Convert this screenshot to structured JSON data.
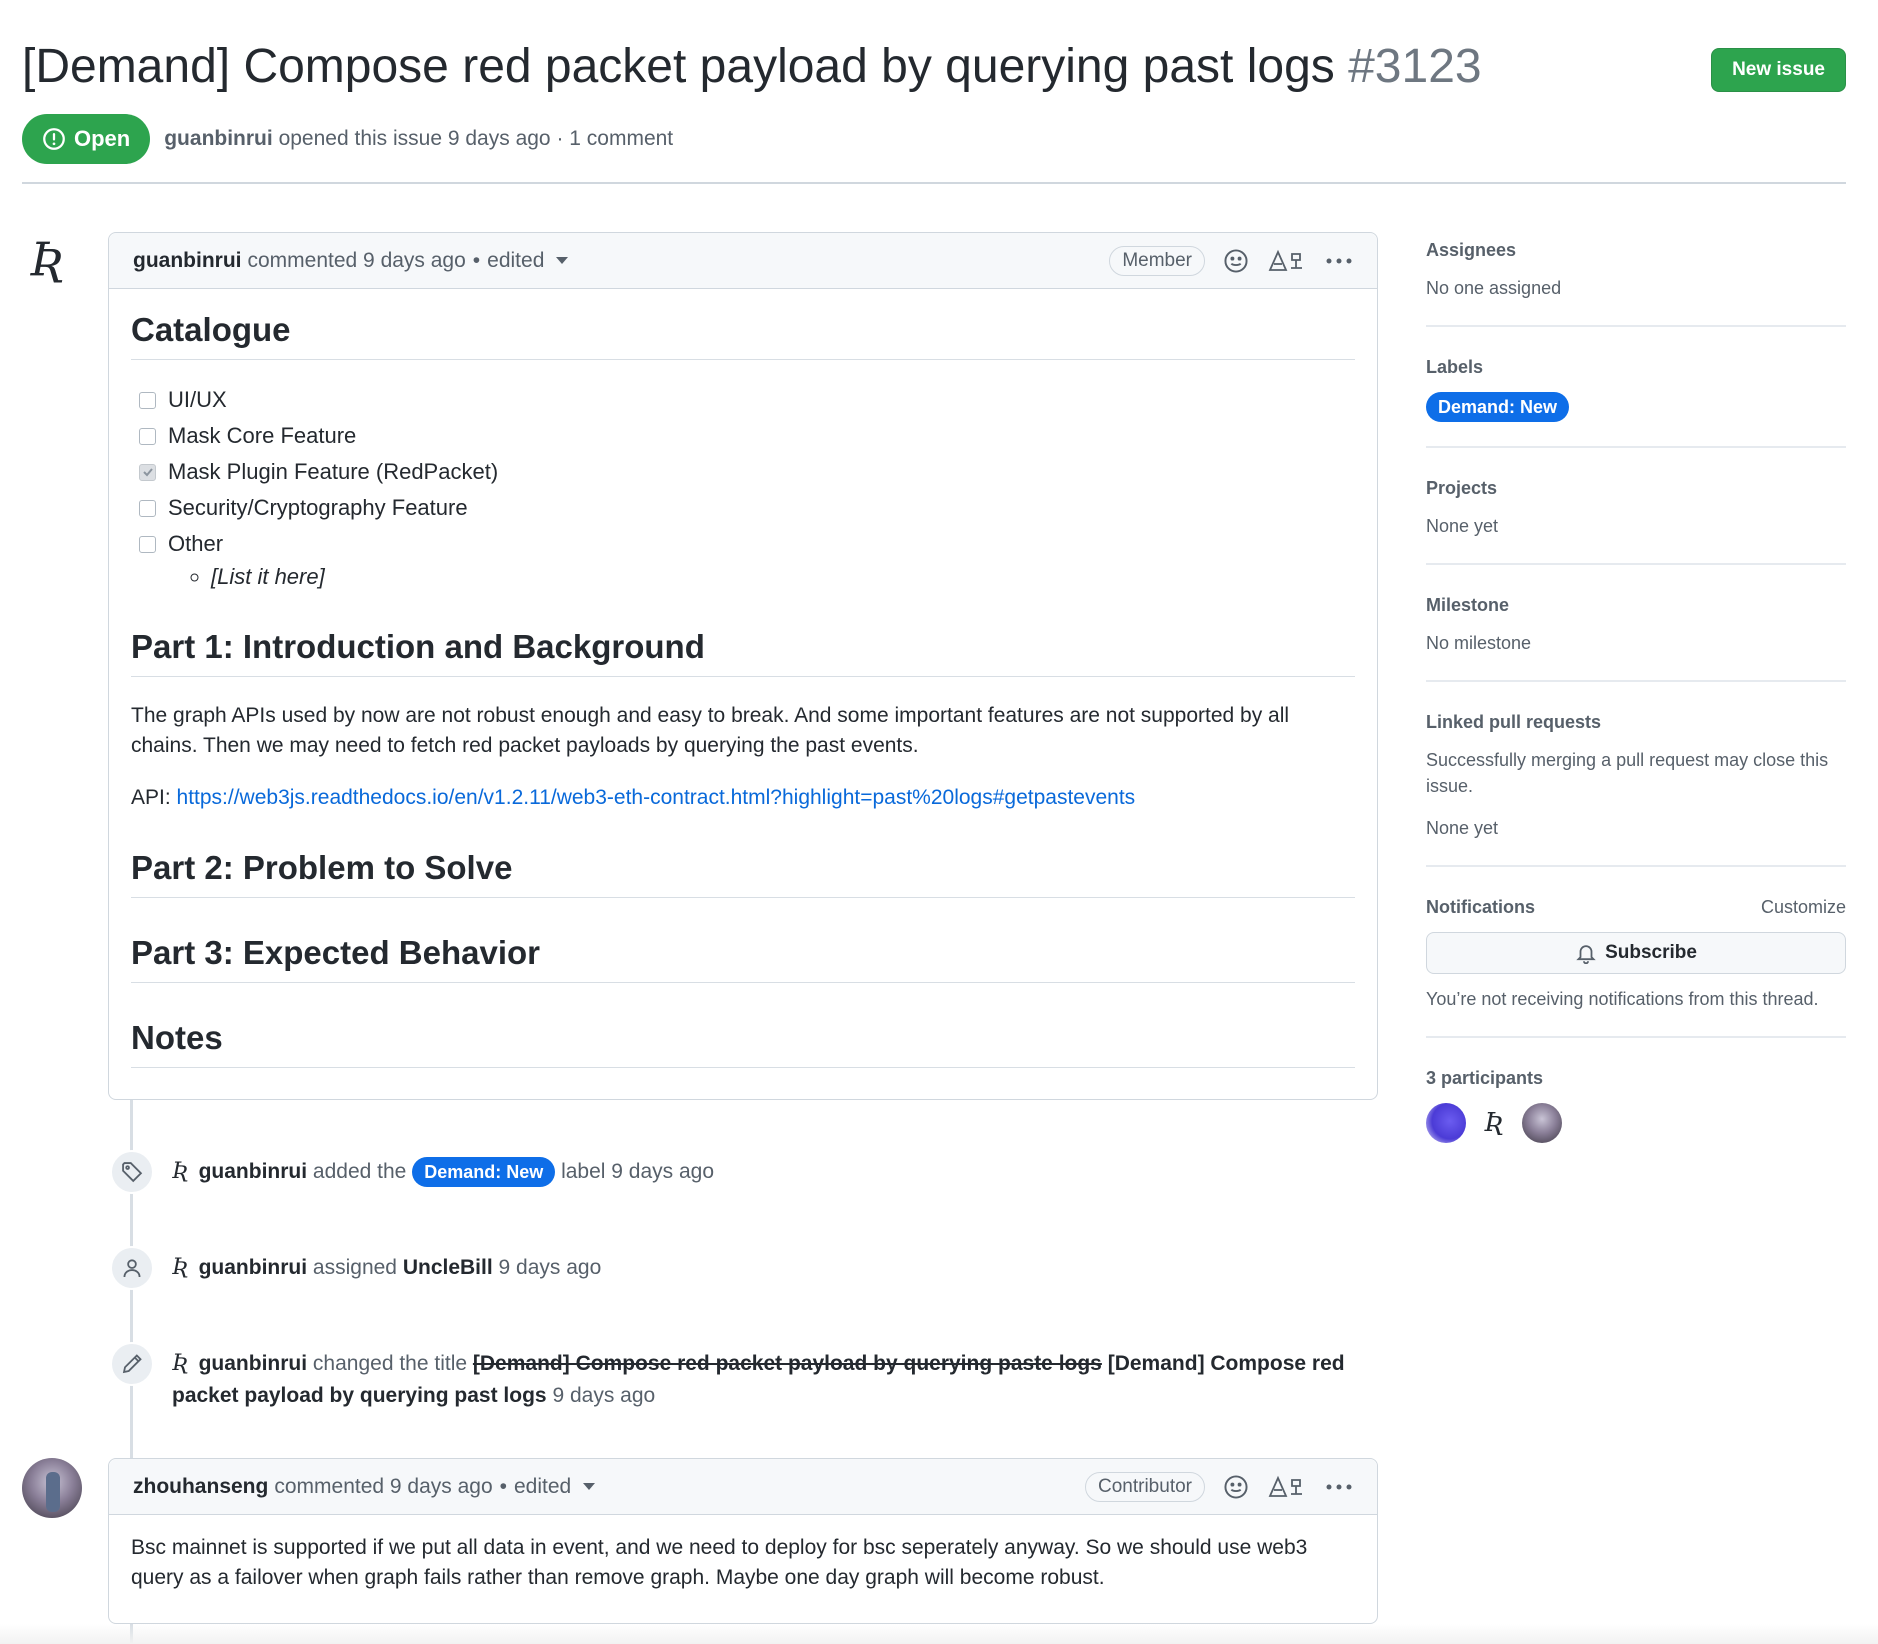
{
  "header": {
    "title": "[Demand] Compose red packet payload by querying past logs",
    "number": "#3123",
    "new_issue_label": "New issue",
    "state": "Open",
    "author": "guanbinrui",
    "opened_text": "opened this issue 9 days ago · 1 comment"
  },
  "first_comment": {
    "author": "guanbinrui",
    "commented": "commented 9 days ago",
    "edited": "edited",
    "role": "Member",
    "catalogue_heading": "Catalogue",
    "tasks": [
      {
        "label": "UI/UX",
        "checked": false
      },
      {
        "label": "Mask Core Feature",
        "checked": false
      },
      {
        "label": "Mask Plugin Feature (RedPacket)",
        "checked": true
      },
      {
        "label": "Security/Cryptography Feature",
        "checked": false
      },
      {
        "label": "Other",
        "checked": false
      }
    ],
    "other_sub": "[List it here]",
    "part1_heading": "Part 1: Introduction and Background",
    "part1_text": "The graph APIs used by now are not robust enough and easy to break. And some important features are not supported by all chains. Then we may need to fetch red packet payloads by querying the past events.",
    "api_prefix": "API:",
    "api_link": "https://web3js.readthedocs.io/en/v1.2.11/web3-eth-contract.html?highlight=past%20logs#getpastevents",
    "part2_heading": "Part 2: Problem to Solve",
    "part3_heading": "Part 3: Expected Behavior",
    "notes_heading": "Notes"
  },
  "events": {
    "label_event": {
      "actor": "guanbinrui",
      "pre": "added the",
      "label": "Demand: New",
      "post": "label 9 days ago"
    },
    "assign_event": {
      "actor": "guanbinrui",
      "pre": "assigned",
      "assignee": "UncleBill",
      "post": "9 days ago"
    },
    "title_event": {
      "actor": "guanbinrui",
      "pre": "changed the title",
      "old_title": "[Demand] Compose red packet payload by querying paste logs",
      "new_title": "[Demand] Compose red packet payload by querying past logs",
      "post": "9 days ago"
    }
  },
  "second_comment": {
    "author": "zhouhanseng",
    "commented": "commented 9 days ago",
    "edited": "edited",
    "role": "Contributor",
    "text": "Bsc mainnet is supported if we put all data in event, and we need to deploy for bsc seperately anyway. So we should use web3 query as a failover when graph fails rather than remove graph. Maybe one day graph will become robust."
  },
  "sidebar": {
    "assignees_heading": "Assignees",
    "assignees_value": "No one assigned",
    "labels_heading": "Labels",
    "label_value": "Demand: New",
    "projects_heading": "Projects",
    "projects_value": "None yet",
    "milestone_heading": "Milestone",
    "milestone_value": "No milestone",
    "linked_heading": "Linked pull requests",
    "linked_desc": "Successfully merging a pull request may close this issue.",
    "linked_value": "None yet",
    "notifications_heading": "Notifications",
    "customize": "Customize",
    "subscribe": "Subscribe",
    "notifications_desc": "You’re not receiving notifications from this thread.",
    "participants_heading": "3 participants"
  },
  "colors": {
    "open_green": "#2da44e",
    "label_blue": "#0e6ee8",
    "link": "#0969da"
  }
}
